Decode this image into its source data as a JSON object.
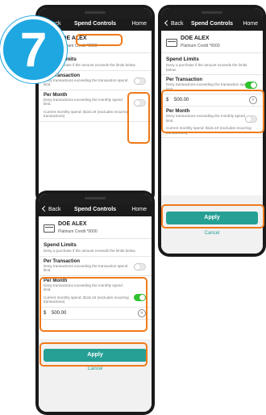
{
  "step_badge": "7",
  "nav": {
    "back": "Back",
    "title": "Spend Controls",
    "home": "Home"
  },
  "account": {
    "name": "DOE ALEX",
    "card": "Platinum Credit *0000"
  },
  "spend_limits": {
    "title": "Spend Limits",
    "desc": "Deny a purchase if the amount exceeds the limits below."
  },
  "per_transaction": {
    "title": "Per Transaction",
    "desc": "Deny transactions exceeding the transaction spend limit."
  },
  "per_month": {
    "title": "Per Month",
    "desc": "Deny transactions exceeding the monthly spend limit.",
    "spend_note": "Current monthly spend: $115.19 (excludes recurring transactions)"
  },
  "amount": {
    "currency": "$",
    "value": "500.00"
  },
  "apply": "Apply",
  "cancel": "Cancel",
  "colors": {
    "accent": "#26a095",
    "highlight": "#f07a1a",
    "toggle_on": "#2ec22e",
    "badge": "#1ea7e1"
  },
  "states": {
    "phone_a": {
      "per_transaction_on": false,
      "per_month_on": false
    },
    "phone_b": {
      "per_transaction_on": true,
      "per_month_on": false
    },
    "phone_c": {
      "per_transaction_on": false,
      "per_month_on": true
    }
  }
}
